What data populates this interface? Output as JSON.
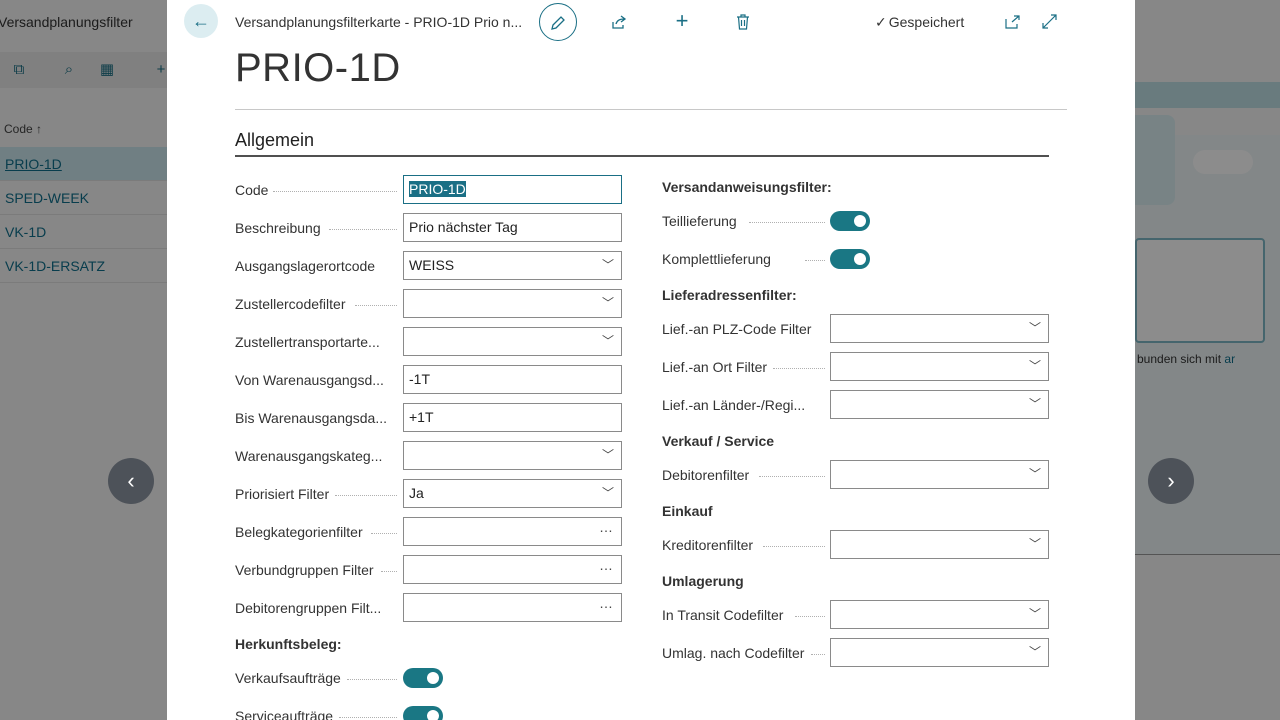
{
  "background": {
    "title": "Versandplanungsfilter",
    "column_header": "Code ↑",
    "rows": [
      "PRIO-1D",
      "SPED-WEEK",
      "VK-1D",
      "VK-1D-ERSATZ"
    ],
    "footer_text": "bunden sich mit",
    "footer_link": "ar"
  },
  "card": {
    "breadcrumb": "Versandplanungsfilterkarte - PRIO-1D Prio n...",
    "status": "Gespeichert",
    "title": "PRIO-1D",
    "section": "Allgemein"
  },
  "left_fields": [
    {
      "label": "Code",
      "value": "PRIO-1D",
      "type": "text-selected"
    },
    {
      "label": "Beschreibung",
      "value": "Prio nächster Tag",
      "type": "text"
    },
    {
      "label": "Ausgangslagerortcode",
      "value": "WEISS",
      "type": "dropdown"
    },
    {
      "label": "Zustellercodefilter",
      "value": "",
      "type": "dropdown"
    },
    {
      "label": "Zustellertransportarte...",
      "value": "",
      "type": "dropdown"
    },
    {
      "label": "Von Warenausgangsd...",
      "value": "-1T",
      "type": "text"
    },
    {
      "label": "Bis Warenausgangsda...",
      "value": "+1T",
      "type": "text"
    },
    {
      "label": "Warenausgangskateg...",
      "value": "",
      "type": "dropdown"
    },
    {
      "label": "Priorisiert Filter",
      "value": "Ja",
      "type": "dropdown"
    },
    {
      "label": "Belegkategorienfilter",
      "value": "",
      "type": "lookup"
    },
    {
      "label": "Verbundgruppen Filter",
      "value": "",
      "type": "lookup"
    },
    {
      "label": "Debitorengruppen Filt...",
      "value": "",
      "type": "lookup"
    }
  ],
  "herkunft": {
    "heading": "Herkunftsbeleg:",
    "toggles": [
      {
        "label": "Verkaufsaufträge",
        "on": true
      },
      {
        "label": "Serviceaufträge",
        "on": true
      }
    ]
  },
  "right": {
    "versand_heading": "Versandanweisungsfilter:",
    "versand_toggles": [
      {
        "label": "Teillieferung",
        "on": true
      },
      {
        "label": "Komplettlieferung",
        "on": true
      }
    ],
    "liefer_heading": "Lieferadressenfilter:",
    "liefer_fields": [
      {
        "label": "Lief.-an PLZ-Code Filter",
        "value": ""
      },
      {
        "label": "Lief.-an Ort Filter",
        "value": ""
      },
      {
        "label": "Lief.-an Länder-/Regi...",
        "value": ""
      }
    ],
    "verkauf_heading": "Verkauf / Service",
    "verkauf_fields": [
      {
        "label": "Debitorenfilter",
        "value": ""
      }
    ],
    "einkauf_heading": "Einkauf",
    "einkauf_fields": [
      {
        "label": "Kreditorenfilter",
        "value": ""
      }
    ],
    "umlag_heading": "Umlagerung",
    "umlag_fields": [
      {
        "label": "In Transit Codefilter",
        "value": ""
      },
      {
        "label": "Umlag. nach Codefilter",
        "value": ""
      }
    ]
  },
  "icons": {
    "back": "arrow-left-icon",
    "edit": "pencil-icon",
    "share": "share-icon",
    "new": "plus-icon",
    "delete": "trash-icon",
    "saved": "checkmark-icon",
    "open_new": "open-in-new-window-icon",
    "expand": "expand-icon"
  },
  "colors": {
    "accent": "#1a6f85",
    "toggle_on": "#1a7784"
  }
}
